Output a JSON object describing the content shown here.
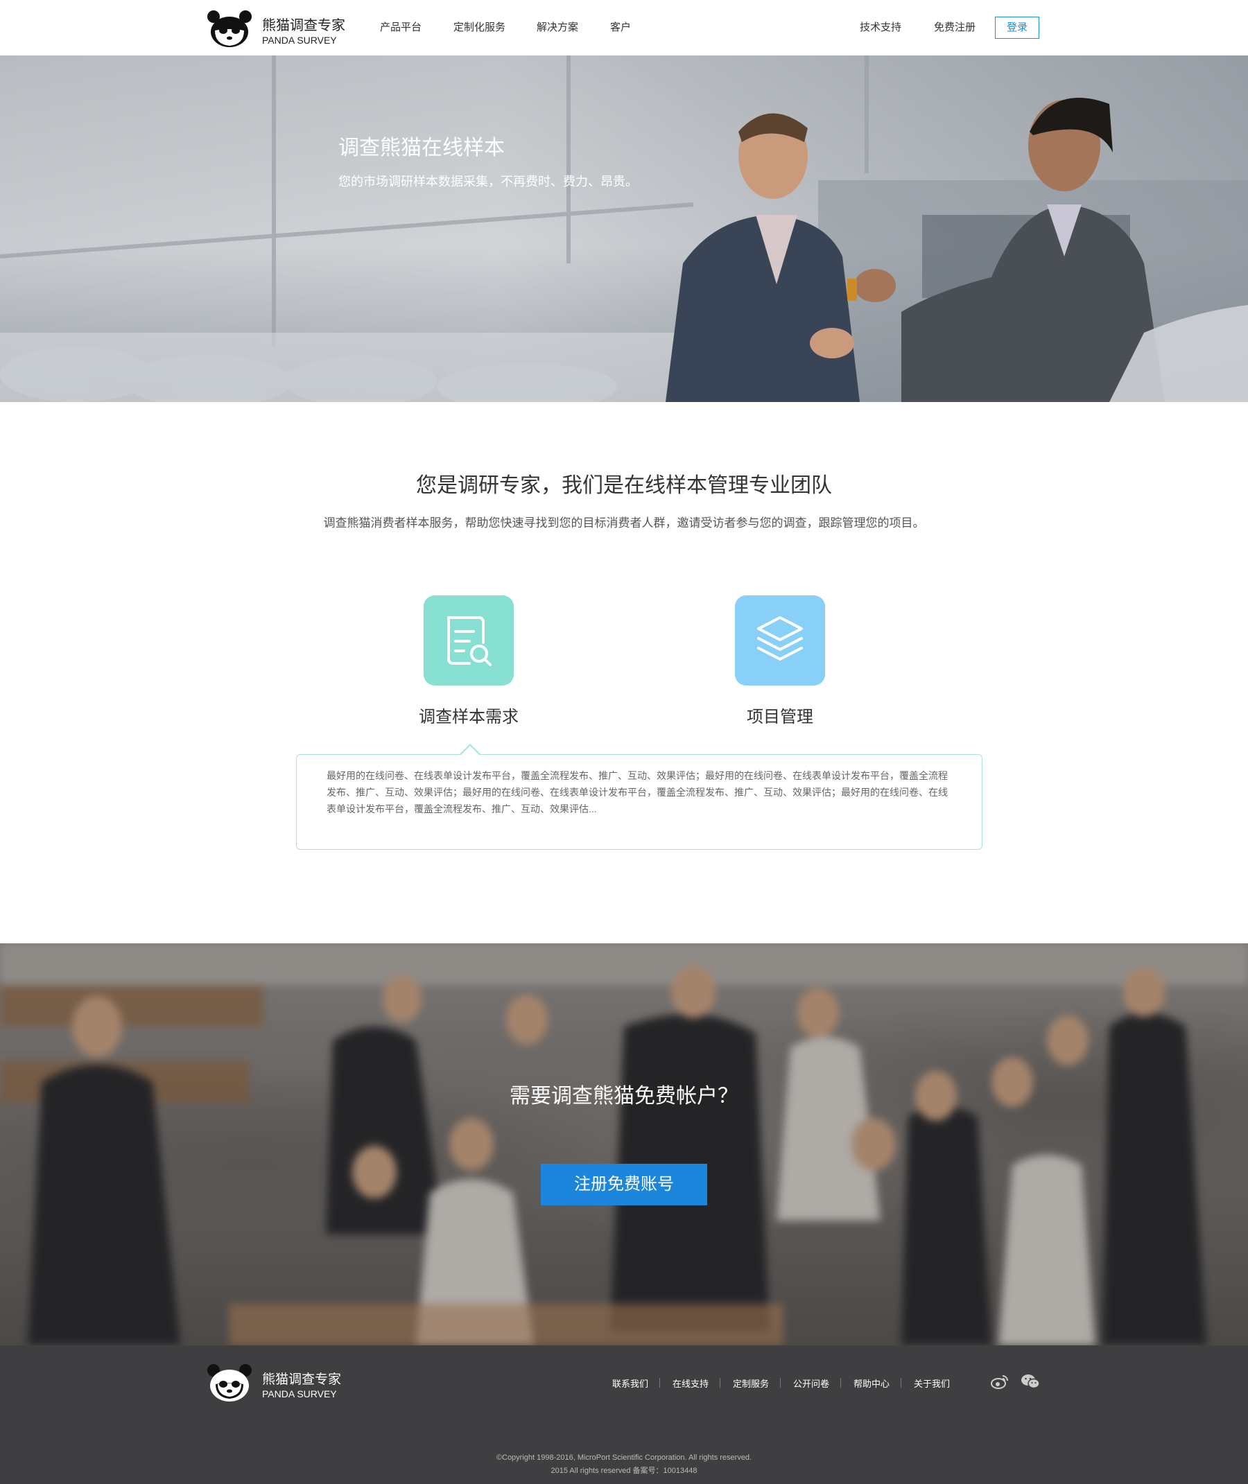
{
  "header": {
    "logo_cn": "熊猫调查专家",
    "logo_en": "PANDA SURVEY",
    "nav": [
      "产品平台",
      "定制化服务",
      "解决方案",
      "客户"
    ],
    "right_nav": [
      "技术支持",
      "免费注册"
    ],
    "login": "登录"
  },
  "hero": {
    "title": "调查熊猫在线样本",
    "subtitle": "您的市场调研样本数据采集，不再费时、费力、昂贵。"
  },
  "intro": {
    "title": "您是调研专家，我们是在线样本管理专业团队",
    "description": "调查熊猫消费者样本服务，帮助您快速寻找到您的目标消费者人群，邀请受访者参与您的调查，跟踪管理您的项目。"
  },
  "features": [
    {
      "label": "调查样本需求",
      "icon": "document-search-icon",
      "color": "#88e0d2"
    },
    {
      "label": "项目管理",
      "icon": "layers-icon",
      "color": "#88d0f8"
    }
  ],
  "feature_description": "最好用的在线问卷、在线表单设计发布平台，覆盖全流程发布、推广、互动、效果评估；最好用的在线问卷、在线表单设计发布平台，覆盖全流程发布、推广、互动、效果评估；最好用的在线问卷、在线表单设计发布平台，覆盖全流程发布、推广、互动、效果评估；最好用的在线问卷、在线表单设计发布平台，覆盖全流程发布、推广、互动、效果评估...",
  "cta": {
    "title": "需要调查熊猫免费帐户？",
    "button": "注册免费账号"
  },
  "footer": {
    "logo_cn": "熊猫调查专家",
    "logo_en": "PANDA SURVEY",
    "links": [
      "联系我们",
      "在线支持",
      "定制服务",
      "公开问卷",
      "帮助中心",
      "关于我们"
    ],
    "social": [
      "weibo-icon",
      "wechat-icon"
    ],
    "copyright_1": "©Copyright 1998-2016, MicroPort Scientific Corporation. All rights reserved.",
    "copyright_2": "2015 All rights reserved 备案号：10013448"
  },
  "colors": {
    "accent": "#1a8ee0",
    "cta_button": "#1c86dc",
    "footer_bg": "#3f3f42",
    "box_border": "#a7e4de"
  }
}
